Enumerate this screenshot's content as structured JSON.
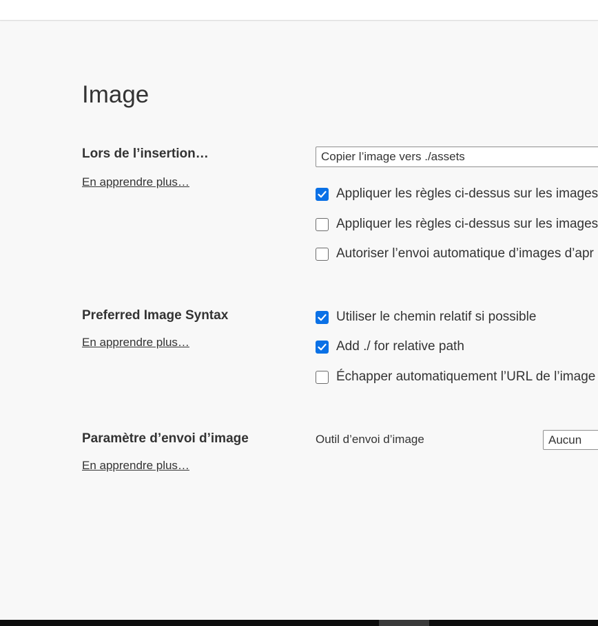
{
  "page": {
    "title": "Image"
  },
  "sections": {
    "insertion": {
      "title": "Lors de l’insertion…",
      "learn_more": "En apprendre plus…",
      "select_value": "Copier l’image vers ./assets",
      "checkboxes": [
        {
          "label": "Appliquer les règles ci-dessus sur les images",
          "checked": true
        },
        {
          "label": "Appliquer les règles ci-dessus sur les images",
          "checked": false
        },
        {
          "label": "Autoriser l’envoi automatique d’images d’apr",
          "checked": false
        }
      ]
    },
    "syntax": {
      "title": "Preferred Image Syntax",
      "learn_more": "En apprendre plus…",
      "checkboxes": [
        {
          "label": "Utiliser le chemin relatif si possible",
          "checked": true
        },
        {
          "label": "Add ./ for relative path",
          "checked": true
        },
        {
          "label": "Échapper automatiquement l’URL de l’image",
          "checked": false
        }
      ]
    },
    "upload": {
      "title": "Paramètre d’envoi d’image",
      "learn_more": "En apprendre plus…",
      "tool_label": "Outil d’envoi d’image",
      "tool_value": "Aucun"
    }
  },
  "colors": {
    "accent": "#0b71e6",
    "background": "#f8f8f8"
  }
}
